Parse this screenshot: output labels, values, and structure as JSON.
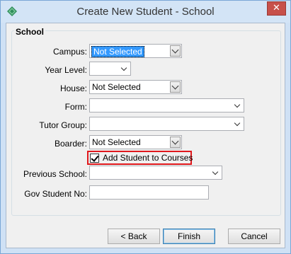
{
  "window": {
    "title": "Create New Student - School",
    "close_glyph": "✕"
  },
  "group": {
    "title": "School"
  },
  "fields": {
    "campus": {
      "label": "Campus:",
      "value": "Not Selected"
    },
    "year_level": {
      "label": "Year Level:",
      "value": ""
    },
    "house": {
      "label": "House:",
      "value": "Not Selected"
    },
    "form": {
      "label": "Form:",
      "value": ""
    },
    "tutor_group": {
      "label": "Tutor Group:",
      "value": ""
    },
    "boarder": {
      "label": "Boarder:",
      "value": "Not Selected"
    },
    "add_to_courses": {
      "label": "Add Student to Courses",
      "checked": true
    },
    "previous_school": {
      "label": "Previous School:",
      "value": ""
    },
    "gov_student_no": {
      "label": "Gov Student No:",
      "value": ""
    }
  },
  "buttons": {
    "back": "< Back",
    "finish": "Finish",
    "cancel": "Cancel"
  },
  "colors": {
    "highlight_border": "#e0181c",
    "selection": "#3399ff",
    "title_bar": "#d3e4f6"
  },
  "icons": {
    "app": "diamond-app-icon",
    "close": "close-icon",
    "dropdown": "chevron-down-icon",
    "check": "checkmark-icon"
  }
}
